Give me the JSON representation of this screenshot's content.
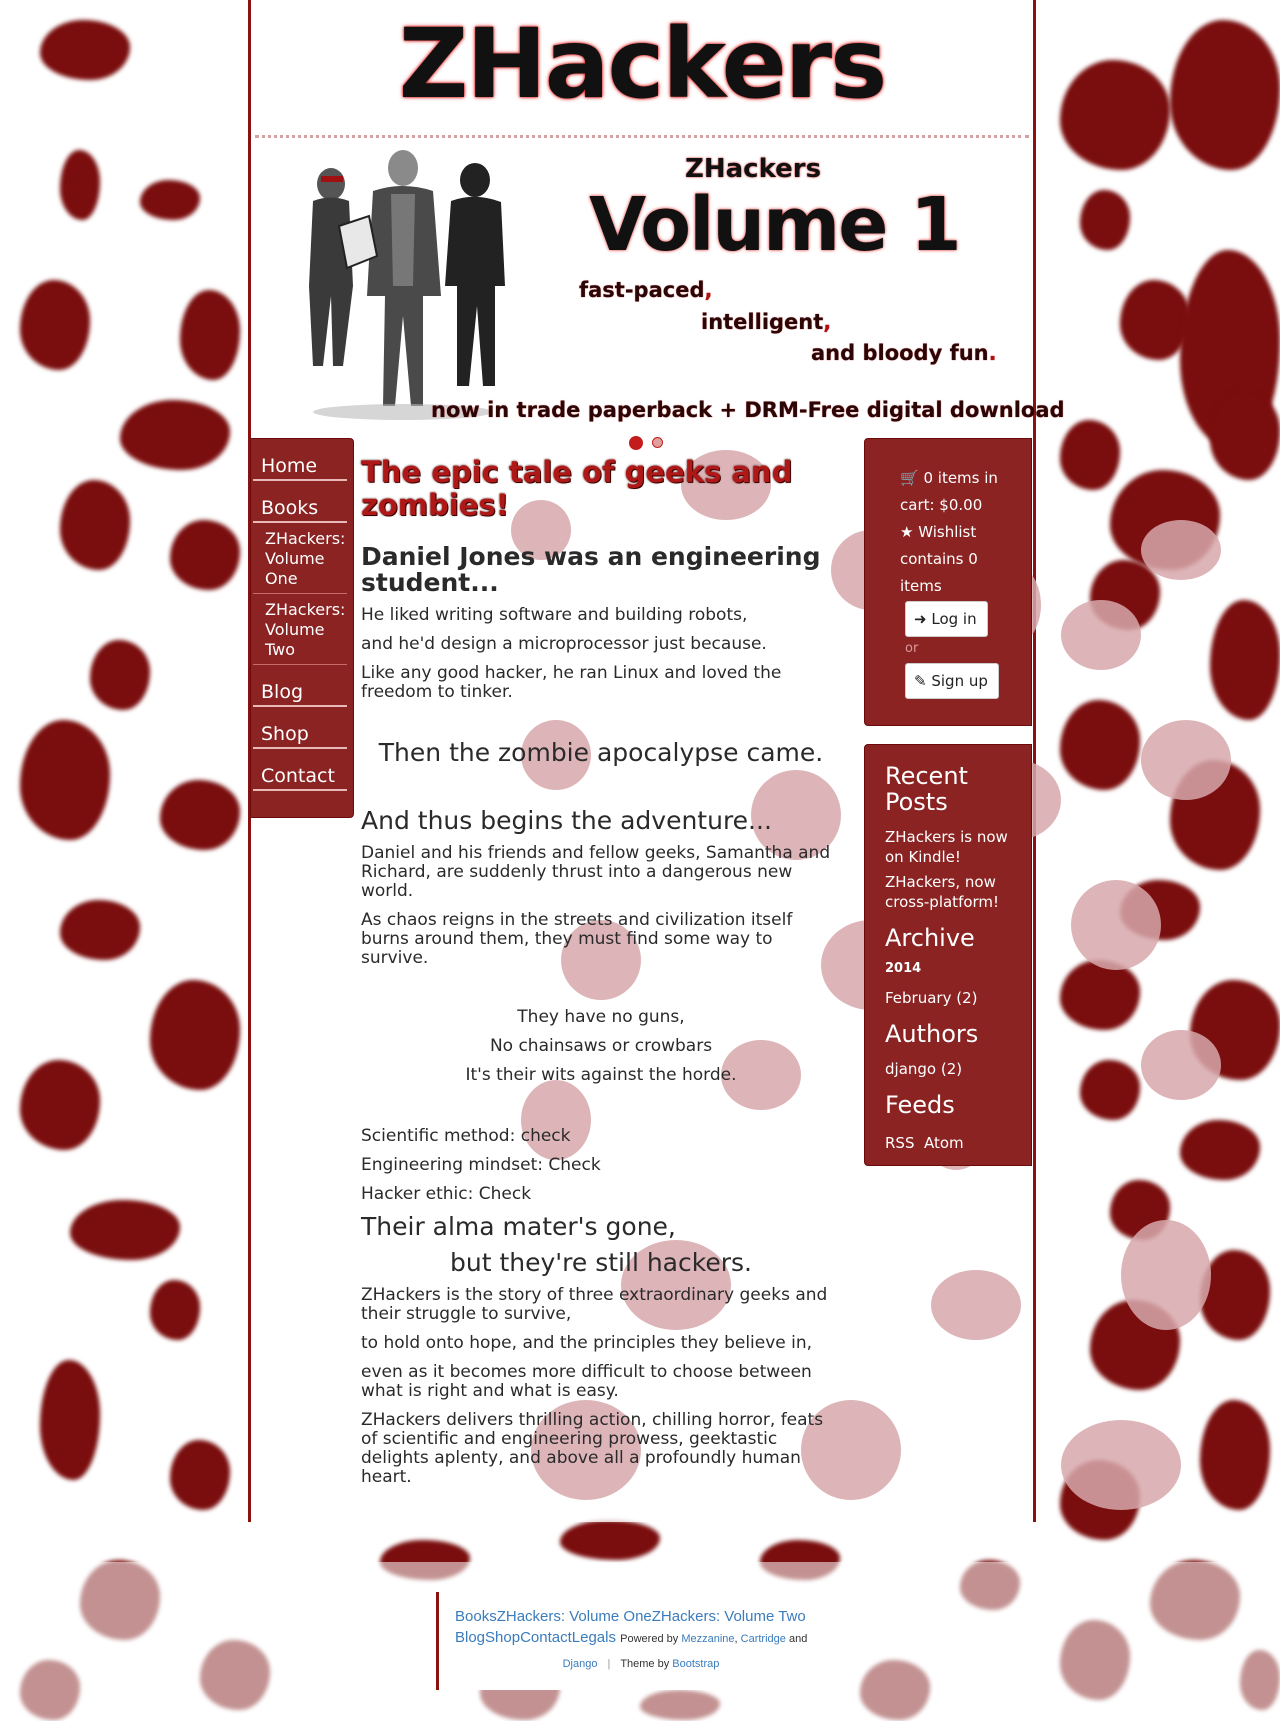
{
  "brand": {
    "title": "ZHackers"
  },
  "banner": {
    "series": "ZHackers",
    "volume": "Volume 1",
    "tag1": "fast-paced",
    "tag2": "intelligent",
    "tag3": "and bloody fun",
    "cta": "now in trade paperback + DRM-Free  digital download",
    "active_slide": 1,
    "slide_count": 2
  },
  "nav": {
    "home": "Home",
    "books": "Books",
    "vol1": "ZHackers: Volume One",
    "vol2": "ZHackers: Volume Two",
    "blog": "Blog",
    "shop": "Shop",
    "contact": "Contact"
  },
  "main": {
    "heading": "The epic tale of geeks and zombies!",
    "intro_heading": "Daniel Jones was an engineering student...",
    "p1": "He liked writing software and building robots,",
    "p2": "and he'd design a microprocessor just because.",
    "p3": "Like any good hacker, he ran Linux and loved the freedom to tinker.",
    "apocalypse": "Then the zombie apocalypse came.",
    "adventure": "And thus begins the adventure...",
    "p4": "Daniel and his friends and fellow geeks, Samantha and Richard, are suddenly thrust into a dangerous new world.",
    "p5": "As chaos reigns in the streets and civilization itself burns around them, they must find some way to survive.",
    "c1": "They have no guns,",
    "c2": "No chainsaws or crowbars",
    "c3": "It's their wits against the horde.",
    "l1": "Scientific method: check",
    "l2": "Engineering mindset: Check",
    "l3": "Hacker ethic: Check",
    "alma1": "Their alma mater's gone,",
    "alma2": "but they're still hackers.",
    "p6": "ZHackers is the story of three extraordinary geeks and their struggle to survive,",
    "p7": "to hold onto hope, and the principles they believe in,",
    "p8": "even as it becomes more difficult to choose between what is right and what is easy.",
    "p9": "ZHackers delivers thrilling action, chilling horror, feats of scientific and engineering prowess, geektastic delights aplenty, and above all a profoundly human heart."
  },
  "cart": {
    "items_text": "0 items in cart: $0.00",
    "wishlist_text": "Wishlist contains 0 items",
    "login": "Log in",
    "or": "or",
    "signup": "Sign up"
  },
  "sidebar": {
    "recent_heading": "Recent Posts",
    "post1": "ZHackers is now on Kindle!",
    "post2": "ZHackers, now cross-platform!",
    "archive_heading": "Archive",
    "archive_year": "2014",
    "archive_month": "February (2)",
    "authors_heading": "Authors",
    "author1": "django (2)",
    "feeds_heading": "Feeds",
    "rss": "RSS",
    "atom": "Atom"
  },
  "footer": {
    "links": [
      "Books",
      "ZHackers: Volume One",
      "ZHackers: Volume Two",
      "Blog",
      "Shop",
      "Contact",
      "Legals"
    ],
    "powered_by": "Powered by",
    "mezzanine": "Mezzanine",
    "cartridge": "Cartridge",
    "and": "and",
    "django": "Django",
    "sep": "|",
    "theme_by": "Theme by",
    "bootstrap": "Bootstrap"
  },
  "colors": {
    "accent": "#8b2323",
    "blood": "#7a0d0d",
    "link": "#3a7cbc"
  }
}
